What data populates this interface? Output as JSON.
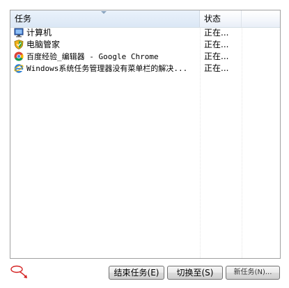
{
  "columns": {
    "task": "任务",
    "status": "状态"
  },
  "tasks": [
    {
      "name": "计算机",
      "status": "正在...",
      "icon": "computer-icon"
    },
    {
      "name": "电脑管家",
      "status": "正在...",
      "icon": "shield-icon"
    },
    {
      "name": "百度经验_编辑器 - Google Chrome",
      "status": "正在...",
      "icon": "chrome-icon"
    },
    {
      "name": "Windows系统任务管理器没有菜单栏的解决...",
      "status": "正在...",
      "icon": "ie-icon"
    }
  ],
  "buttons": {
    "end_task": "结束任务(E)",
    "switch_to": "切换至(S)",
    "new_task": "新任务(N)..."
  },
  "colors": {
    "header_bg": "#eaf2fb",
    "border": "#a0a0a0",
    "help_icon": "#d41f1f"
  }
}
